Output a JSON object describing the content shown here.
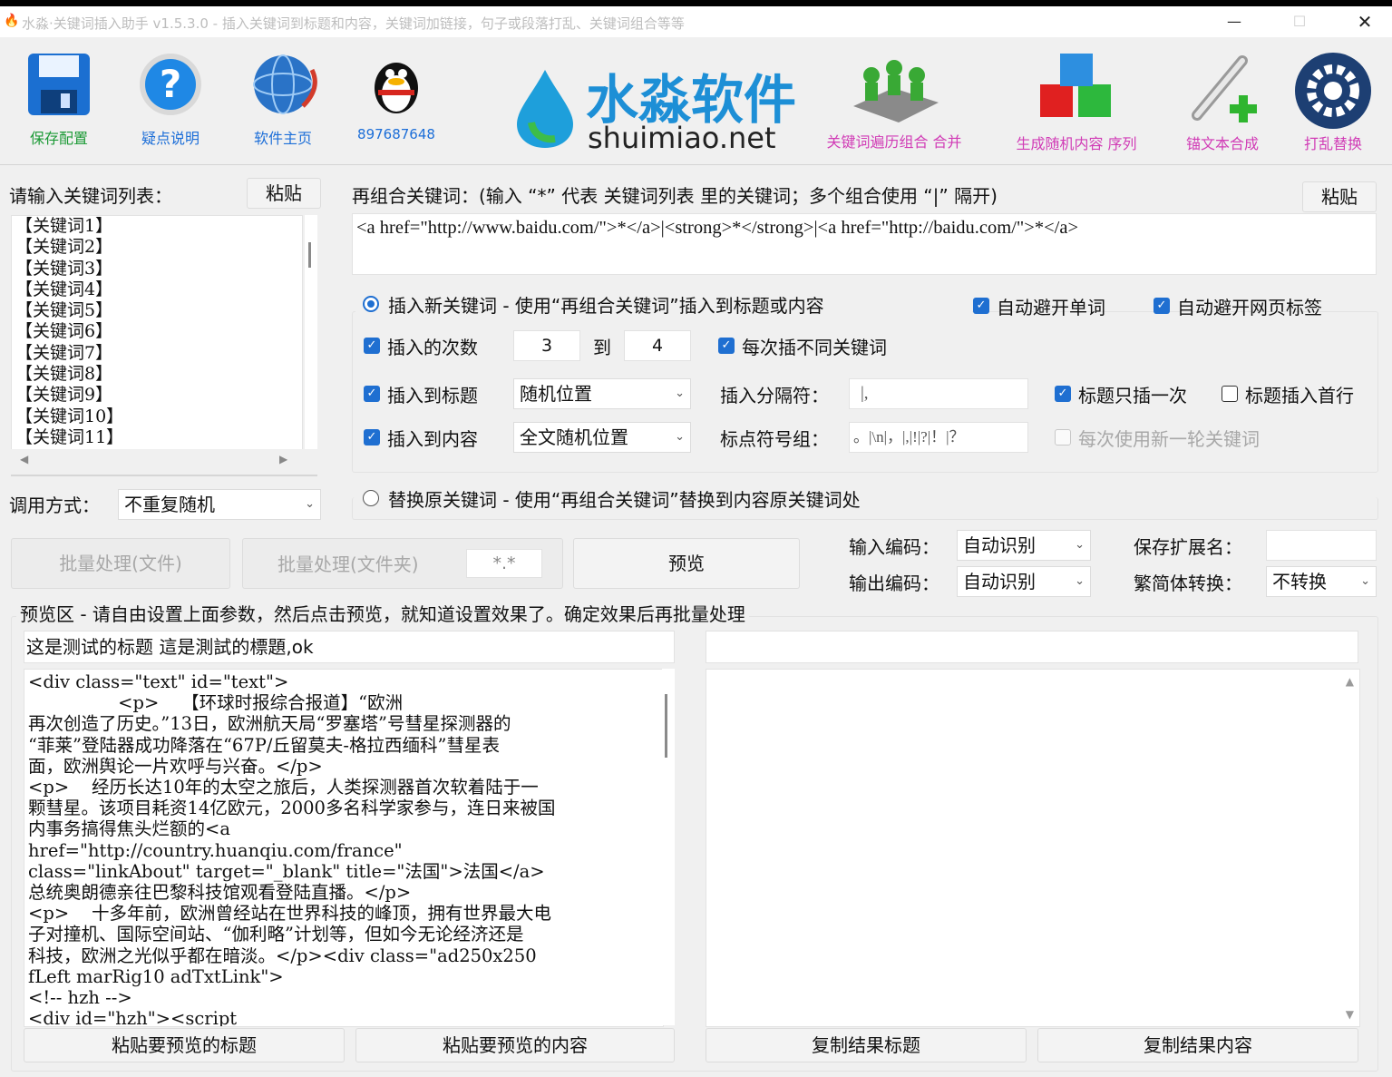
{
  "window": {
    "title": "水淼·关键词插入助手 v1.5.3.0 - 插入关键词到标题和内容，关键词加链接，句子或段落打乱、关键词组合等等"
  },
  "toolbar": {
    "save": "保存配置",
    "help": "疑点说明",
    "home": "软件主页",
    "qq": "897687648",
    "logo_cn": "水淼软件",
    "logo_en": "shuimiao.net",
    "combine": "关键词遍历组合 合并",
    "random": "生成随机内容 序列",
    "anchor": "锚文本合成",
    "shuffle": "打乱替换"
  },
  "keywords": {
    "label": "请输入关键词列表：",
    "paste": "粘贴",
    "items": [
      "【关键词1】",
      "【关键词2】",
      "【关键词3】",
      "【关键词4】",
      "【关键词5】",
      "【关键词6】",
      "【关键词7】",
      "【关键词8】",
      "【关键词9】",
      "【关键词10】",
      "【关键词11】"
    ],
    "call_label": "调用方式：",
    "call_value": "不重复随机"
  },
  "recombine": {
    "label": "再组合关键词：(输入 “*” 代表 关键词列表 里的关键词；多个组合使用 “|” 隔开)",
    "paste": "粘贴",
    "value": "<a href=\"http://www.baidu.com/\">*</a>|<strong>*</strong>|<a href=\"http://baidu.com/\">*</a>"
  },
  "insert": {
    "radio_label": "插入新关键词 - 使用“再组合关键词”插入到标题或内容",
    "auto_word": "自动避开单词",
    "auto_tag": "自动避开网页标签",
    "times_label": "插入的次数",
    "times_from": "3",
    "to": "到",
    "times_to": "4",
    "diff_kw": "每次插不同关键词",
    "to_title": "插入到标题",
    "title_pos": "随机位置",
    "sep_label": "插入分隔符：",
    "sep_value": "|,",
    "title_once": "标题只插一次",
    "title_first": "标题插入首行",
    "to_content": "插入到内容",
    "content_pos": "全文随机位置",
    "punct_label": "标点符号组：",
    "punct_value": "。|\\n|，|,|!|?|！|？",
    "new_round": "每次使用新一轮关键词"
  },
  "replace": {
    "radio_label": "替换原关键词 - 使用“再组合关键词”替换到内容原关键词处"
  },
  "batch": {
    "file": "批量处理(文件)",
    "folder": "批量处理(文件夹)",
    "ext": "*.*",
    "preview": "预览"
  },
  "encoding": {
    "in_label": "输入编码：",
    "in_value": "自动识别",
    "out_label": "输出编码：",
    "out_value": "自动识别",
    "save_ext_label": "保存扩展名：",
    "save_ext_value": "",
    "conv_label": "繁简体转换：",
    "conv_value": "不转换"
  },
  "preview": {
    "label": "预览区 - 请自由设置上面参数，然后点击预览，就知道设置效果了。确定效果后再批量处理",
    "title_value": "这是测试的标题 這是測試的標題,ok",
    "content_value": "<div class=\"text\" id=\"text\">\n                <p>    【环球时报综合报道】“欧洲\n再次创造了历史。”13日，欧洲航天局“罗塞塔”号彗星探测器的\n“菲莱”登陆器成功降落在“67P/丘留莫夫-格拉西缅科”彗星表\n面，欧洲舆论一片欢呼与兴奋。</p>\n<p>    经历长达10年的太空之旅后，人类探测器首次软着陆于一\n颗彗星。该项目耗资14亿欧元，2000多名科学家参与，连日来被国\n内事务搞得焦头烂额的<a\nhref=\"http://country.huanqiu.com/france\"\nclass=\"linkAbout\" target=\"_blank\" title=\"法国\">法国</a>\n总统奥朗德亲往巴黎科技馆观看登陆直播。</p>\n<p>    十多年前，欧洲曾经站在世界科技的峰顶，拥有世界最大电\n子对撞机、国际空间站、“伽利略”计划等，但如今无论经济还是\n科技，欧洲之光似乎都在暗淡。</p><div class=\"ad250x250\nfLeft marRig10 adTxtLink\">\n<!-- hzh -->\n<div id=\"hzh\"><script",
    "result_title": "",
    "result_content": "",
    "paste_title": "粘贴要预览的标题",
    "paste_content": "粘贴要预览的内容",
    "copy_title": "复制结果标题",
    "copy_content": "复制结果内容"
  },
  "colors": {
    "label_green": "#1c9a36",
    "label_blue": "#1c6ed8",
    "label_magenta": "#d13cb6",
    "accent": "#1f6fd1"
  }
}
